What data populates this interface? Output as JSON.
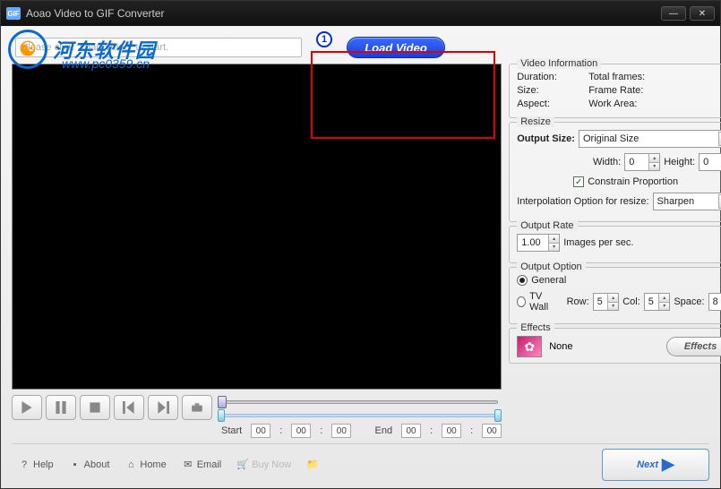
{
  "titlebar": {
    "icon_text": "GIF",
    "title": "Aoao Video to GIF Converter"
  },
  "watermark": {
    "logo": "☯",
    "line1": "河东软件园",
    "line2": "www.pc0359.cn"
  },
  "fileinput": {
    "placeholder": "Please click \"Load Video\" to start."
  },
  "load_button": "Load Video",
  "annotation": {
    "num": "1"
  },
  "video_info": {
    "legend": "Video Information",
    "duration_lbl": "Duration:",
    "size_lbl": "Size:",
    "aspect_lbl": "Aspect:",
    "totalframes_lbl": "Total frames:",
    "framerate_lbl": "Frame Rate:",
    "workarea_lbl": "Work Area:"
  },
  "resize": {
    "legend": "Resize",
    "outputsize_lbl": "Output Size:",
    "outputsize_val": "Original Size",
    "width_lbl": "Width:",
    "width_val": "0",
    "height_lbl": "Height:",
    "height_val": "0",
    "constrain_lbl": "Constrain Proportion",
    "constrain_checked": true,
    "interp_lbl": "Interpolation Option for resize:",
    "interp_val": "Sharpen"
  },
  "output_rate": {
    "legend": "Output Rate",
    "value": "1.00",
    "unit": "Images per sec."
  },
  "output_option": {
    "legend": "Output Option",
    "general_lbl": "General",
    "tvwall_lbl": "TV Wall",
    "row_lbl": "Row:",
    "row_val": "5",
    "col_lbl": "Col:",
    "col_val": "5",
    "space_lbl": "Space:",
    "space_val": "8"
  },
  "effects": {
    "legend": "Effects",
    "value": "None",
    "btn": "Effects"
  },
  "time": {
    "start_lbl": "Start",
    "end_lbl": "End",
    "zero": "00"
  },
  "footer": {
    "help": "Help",
    "about": "About",
    "home": "Home",
    "email": "Email",
    "buy": "Buy Now",
    "next": "Next"
  }
}
